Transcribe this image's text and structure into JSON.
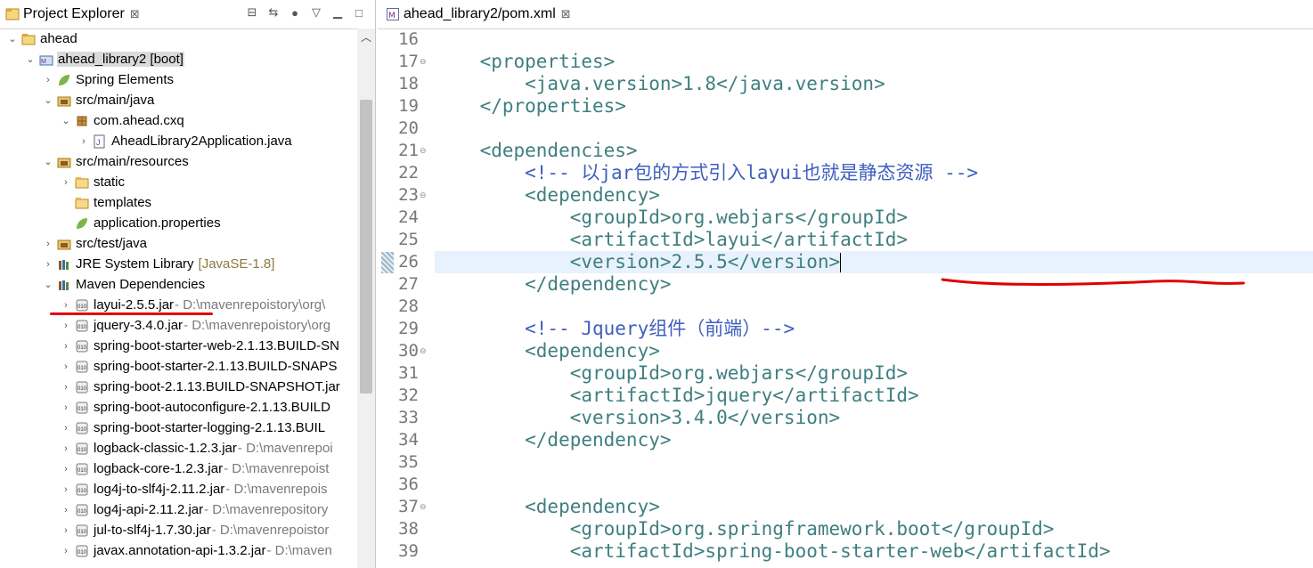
{
  "explorer": {
    "title": "Project Explorer",
    "close": "⊠",
    "items": [
      {
        "label": "ahead",
        "indent": 0,
        "twisty": "v",
        "icon": "project-icon"
      },
      {
        "label": "ahead_library2 [boot]",
        "indent": 1,
        "twisty": "v",
        "icon": "maven-project-icon",
        "selected": true
      },
      {
        "label": "Spring Elements",
        "indent": 2,
        "twisty": ">",
        "icon": "spring-leaf-icon"
      },
      {
        "label": "src/main/java",
        "indent": 2,
        "twisty": "v",
        "icon": "source-folder-icon"
      },
      {
        "label": "com.ahead.cxq",
        "indent": 3,
        "twisty": "v",
        "icon": "package-icon"
      },
      {
        "label": "AheadLibrary2Application.java",
        "indent": 4,
        "twisty": ">",
        "icon": "java-file-icon"
      },
      {
        "label": "src/main/resources",
        "indent": 2,
        "twisty": "v",
        "icon": "source-folder-icon"
      },
      {
        "label": "static",
        "indent": 3,
        "twisty": ">",
        "icon": "folder-icon"
      },
      {
        "label": "templates",
        "indent": 3,
        "twisty": "",
        "icon": "folder-icon"
      },
      {
        "label": "application.properties",
        "indent": 3,
        "twisty": "",
        "icon": "spring-leaf-icon"
      },
      {
        "label": "src/test/java",
        "indent": 2,
        "twisty": ">",
        "icon": "source-folder-icon"
      },
      {
        "label": "JRE System Library",
        "dec": "[JavaSE-1.8]",
        "indent": 2,
        "twisty": ">",
        "icon": "library-icon"
      },
      {
        "label": "Maven Dependencies",
        "indent": 2,
        "twisty": "v",
        "icon": "library-icon"
      },
      {
        "label": "layui-2.5.5.jar",
        "path": " - D:\\mavenrepoistory\\org\\",
        "indent": 3,
        "twisty": ">",
        "icon": "jar-icon"
      },
      {
        "label": "jquery-3.4.0.jar",
        "path": " - D:\\mavenrepoistory\\org",
        "indent": 3,
        "twisty": ">",
        "icon": "jar-icon"
      },
      {
        "label": "spring-boot-starter-web-2.1.13.BUILD-SN",
        "indent": 3,
        "twisty": ">",
        "icon": "jar-icon"
      },
      {
        "label": "spring-boot-starter-2.1.13.BUILD-SNAPS",
        "indent": 3,
        "twisty": ">",
        "icon": "jar-icon"
      },
      {
        "label": "spring-boot-2.1.13.BUILD-SNAPSHOT.jar",
        "indent": 3,
        "twisty": ">",
        "icon": "jar-icon"
      },
      {
        "label": "spring-boot-autoconfigure-2.1.13.BUILD",
        "indent": 3,
        "twisty": ">",
        "icon": "jar-icon"
      },
      {
        "label": "spring-boot-starter-logging-2.1.13.BUIL",
        "indent": 3,
        "twisty": ">",
        "icon": "jar-icon"
      },
      {
        "label": "logback-classic-1.2.3.jar",
        "path": " - D:\\mavenrepoi",
        "indent": 3,
        "twisty": ">",
        "icon": "jar-icon"
      },
      {
        "label": "logback-core-1.2.3.jar",
        "path": " - D:\\mavenrepoist",
        "indent": 3,
        "twisty": ">",
        "icon": "jar-icon"
      },
      {
        "label": "log4j-to-slf4j-2.11.2.jar",
        "path": " - D:\\mavenrepois",
        "indent": 3,
        "twisty": ">",
        "icon": "jar-icon"
      },
      {
        "label": "log4j-api-2.11.2.jar",
        "path": " - D:\\mavenrepository",
        "indent": 3,
        "twisty": ">",
        "icon": "jar-icon"
      },
      {
        "label": "jul-to-slf4j-1.7.30.jar",
        "path": " - D:\\mavenrepoistor",
        "indent": 3,
        "twisty": ">",
        "icon": "jar-icon"
      },
      {
        "label": "javax.annotation-api-1.3.2.jar",
        "path": " - D:\\maven",
        "indent": 3,
        "twisty": ">",
        "icon": "jar-icon"
      }
    ]
  },
  "editor": {
    "tab_label": "ahead_library2/pom.xml",
    "close": "⊠",
    "lines": [
      {
        "n": "16",
        "fold": "",
        "text": ""
      },
      {
        "n": "17",
        "fold": "⊖",
        "text": "    <properties>",
        "kind": "tag"
      },
      {
        "n": "18",
        "fold": "",
        "text": "        <java.version>1.8</java.version>",
        "kind": "tag"
      },
      {
        "n": "19",
        "fold": "",
        "text": "    </properties>",
        "kind": "tag"
      },
      {
        "n": "20",
        "fold": "",
        "text": ""
      },
      {
        "n": "21",
        "fold": "⊖",
        "text": "    <dependencies>",
        "kind": "tag"
      },
      {
        "n": "22",
        "fold": "",
        "text": "        <!-- 以jar包的方式引入layui也就是静态资源 -->",
        "kind": "com"
      },
      {
        "n": "23",
        "fold": "⊖",
        "text": "        <dependency>",
        "kind": "tag"
      },
      {
        "n": "24",
        "fold": "",
        "text": "            <groupId>org.webjars</groupId>",
        "kind": "tag"
      },
      {
        "n": "25",
        "fold": "",
        "text": "            <artifactId>layui</artifactId>",
        "kind": "tag"
      },
      {
        "n": "26",
        "fold": "",
        "text": "            <version>2.5.5</version>",
        "kind": "tag",
        "highlight": true
      },
      {
        "n": "27",
        "fold": "",
        "text": "        </dependency>",
        "kind": "tag"
      },
      {
        "n": "28",
        "fold": "",
        "text": ""
      },
      {
        "n": "29",
        "fold": "",
        "text": "        <!-- Jquery组件（前端）-->",
        "kind": "com"
      },
      {
        "n": "30",
        "fold": "⊖",
        "text": "        <dependency>",
        "kind": "tag"
      },
      {
        "n": "31",
        "fold": "",
        "text": "            <groupId>org.webjars</groupId>",
        "kind": "tag"
      },
      {
        "n": "32",
        "fold": "",
        "text": "            <artifactId>jquery</artifactId>",
        "kind": "tag"
      },
      {
        "n": "33",
        "fold": "",
        "text": "            <version>3.4.0</version>",
        "kind": "tag"
      },
      {
        "n": "34",
        "fold": "",
        "text": "        </dependency>",
        "kind": "tag"
      },
      {
        "n": "35",
        "fold": "",
        "text": ""
      },
      {
        "n": "36",
        "fold": "",
        "text": ""
      },
      {
        "n": "37",
        "fold": "⊖",
        "text": "        <dependency>",
        "kind": "tag"
      },
      {
        "n": "38",
        "fold": "",
        "text": "            <groupId>org.springframework.boot</groupId>",
        "kind": "tag"
      },
      {
        "n": "39",
        "fold": "",
        "text": "            <artifactId>spring-boot-starter-web</artifactId>",
        "kind": "tag"
      }
    ]
  },
  "colors": {
    "tag": "#3f7f7f",
    "comment": "#3f5fbf",
    "annotation": "#e00000",
    "selection": "#dadada",
    "current_line": "#e8f2fe"
  }
}
